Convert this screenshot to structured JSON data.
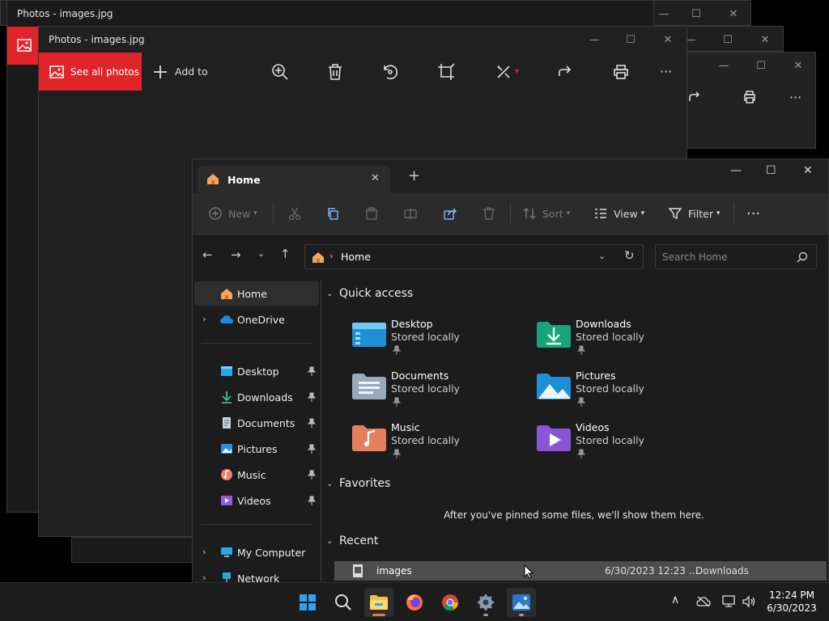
{
  "photos_back": {
    "title": "Photos - images.jpg"
  },
  "photos_front": {
    "title": "Photos - images.jpg",
    "see_all": "See all photos",
    "add_to": "Add to"
  },
  "explorer": {
    "tab_label": "Home",
    "commands": {
      "new": "New",
      "sort": "Sort",
      "view": "View",
      "filter": "Filter"
    },
    "address": "Home",
    "search_placeholder": "Search Home",
    "nav": {
      "home": "Home",
      "onedrive": "OneDrive",
      "pinned": [
        "Desktop",
        "Downloads",
        "Documents",
        "Pictures",
        "Music",
        "Videos"
      ],
      "my_computer": "My Computer",
      "network": "Network"
    },
    "sections": {
      "quick_access": "Quick access",
      "favorites": "Favorites",
      "recent": "Recent"
    },
    "quick_access": [
      {
        "name": "Desktop",
        "status": "Stored locally"
      },
      {
        "name": "Downloads",
        "status": "Stored locally"
      },
      {
        "name": "Documents",
        "status": "Stored locally"
      },
      {
        "name": "Pictures",
        "status": "Stored locally"
      },
      {
        "name": "Music",
        "status": "Stored locally"
      },
      {
        "name": "Videos",
        "status": "Stored locally"
      }
    ],
    "favorites_empty": "After you've pinned some files, we'll show them here.",
    "recent": [
      {
        "name": "images",
        "date": "6/30/2023 12:23 ...",
        "location": "Downloads"
      }
    ]
  },
  "taskbar": {
    "time": "12:24 PM",
    "date": "6/30/2023"
  },
  "colors": {
    "accent_red": "#e0252a",
    "folder_blue": "#3aa0e8"
  }
}
